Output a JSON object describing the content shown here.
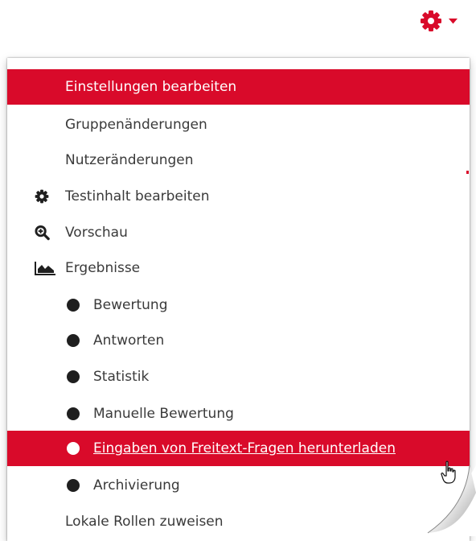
{
  "colors": {
    "accent": "#d90a2a",
    "text": "#3a3a3a",
    "active_text": "#ffffff",
    "bullet": "#1f1f1f"
  },
  "toggle": {
    "icon": "gear-icon",
    "caret_icon": "caret-down-icon"
  },
  "menu": {
    "items": [
      {
        "label": "Einstellungen bearbeiten",
        "active": true
      },
      {
        "label": "Gruppenänderungen"
      },
      {
        "label": "Nutzeränderungen"
      },
      {
        "label": "Testinhalt bearbeiten",
        "icon": "gear-icon"
      },
      {
        "label": "Vorschau",
        "icon": "zoom-in-icon"
      },
      {
        "label": "Ergebnisse",
        "icon": "area-chart-icon"
      },
      {
        "label": "Bewertung",
        "icon": "bullet-icon"
      },
      {
        "label": "Antworten",
        "icon": "bullet-icon"
      },
      {
        "label": "Statistik",
        "icon": "bullet-icon"
      },
      {
        "label": "Manuelle Bewertung",
        "icon": "bullet-icon"
      },
      {
        "label": "Eingaben von Freitext-Fragen herunterladen",
        "icon": "bullet-icon",
        "active": true,
        "hovered": true
      },
      {
        "label": "Archivierung",
        "icon": "bullet-icon"
      },
      {
        "label": "Lokale Rollen zuweisen"
      }
    ]
  }
}
